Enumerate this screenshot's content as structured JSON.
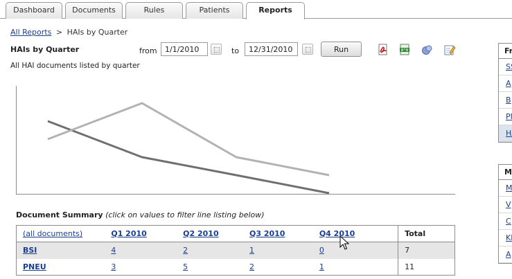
{
  "tabs": [
    {
      "label": "Dashboard",
      "active": false
    },
    {
      "label": "Documents",
      "active": false
    },
    {
      "label": "Rules",
      "active": false
    },
    {
      "label": "Patients",
      "active": false
    },
    {
      "label": "Reports",
      "active": true
    }
  ],
  "breadcrumb": {
    "root": "All Reports",
    "separator": ">",
    "current": "HAIs by Quarter"
  },
  "report": {
    "title": "HAIs by Quarter",
    "subtitle": "All HAI documents listed by quarter",
    "from_label": "from",
    "from_value": "1/1/2010",
    "to_label": "to",
    "to_value": "12/31/2010",
    "run_label": "Run"
  },
  "toolbar_icons": [
    "pdf-icon",
    "csv-icon",
    "chart-type-icon",
    "edit-note-icon"
  ],
  "chart_data": {
    "type": "line",
    "x": [
      "Q1 2010",
      "Q2 2010",
      "Q3 2010",
      "Q4 2010"
    ],
    "series": [
      {
        "values": [
          4,
          2,
          1,
          0
        ],
        "color": "#6f6f6f"
      },
      {
        "values": [
          3,
          5,
          2,
          1
        ],
        "color": "#b2b2b2"
      }
    ],
    "grid": false
  },
  "summary": {
    "heading": "Document Summary",
    "hint": "(click on values to filter line listing below)",
    "columns": [
      "(all documents)",
      "Q1 2010",
      "Q2 2010",
      "Q3 2010",
      "Q4 2010",
      "Total"
    ],
    "rows": [
      {
        "label": "BSI",
        "values": [
          "4",
          "2",
          "1",
          "0"
        ],
        "total": "7"
      },
      {
        "label": "PNEU",
        "values": [
          "3",
          "5",
          "2",
          "1"
        ],
        "total": "11"
      }
    ]
  },
  "side_panels": [
    {
      "header": "Fr",
      "items": [
        "SS",
        "A",
        "B",
        "PN",
        "HA"
      ],
      "selected": 4
    },
    {
      "header": "M",
      "items": [
        "M",
        "V",
        "C",
        "Kl",
        "A"
      ],
      "selected": -1
    }
  ]
}
